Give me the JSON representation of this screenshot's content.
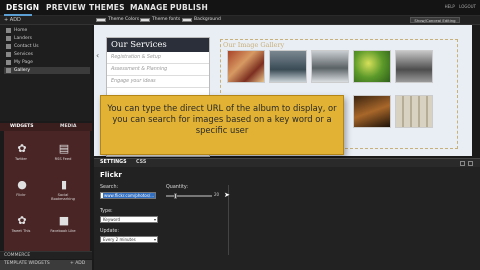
{
  "nav": {
    "tabs": [
      "DESIGN",
      "PREVIEW",
      "THEMES",
      "MANAGE",
      "PUBLISH"
    ],
    "right_links": [
      "HELP",
      "LOGOUT"
    ]
  },
  "toolbar": {
    "add_label": "+ ADD",
    "theme_colors": "Theme Colors",
    "theme_fonts": "Theme fonts",
    "background": "Background",
    "right_button": "Show/Conceal Editing"
  },
  "pages": {
    "items": [
      "Home",
      "Landers",
      "Contact Us",
      "Services",
      "My Page",
      "Gallery"
    ],
    "selected_index": 5
  },
  "widgets_panel": {
    "tabs": [
      "WIDGETS",
      "MEDIA"
    ],
    "items": [
      {
        "label": "Twitter",
        "icon": "twitter-icon"
      },
      {
        "label": "RSS Feed",
        "icon": "rss-icon"
      },
      {
        "label": "Flickr",
        "icon": "flickr-icon"
      },
      {
        "label": "Social Bookmarking",
        "icon": "bookmark-icon"
      },
      {
        "label": "Tweet This",
        "icon": "tweet-icon"
      },
      {
        "label": "Facebook Like",
        "icon": "facebook-icon"
      }
    ]
  },
  "left_footer": {
    "commerce": "COMMERCE",
    "template_widgets": "TEMPLATE WIDGETS",
    "add": "+ ADD"
  },
  "canvas": {
    "services": {
      "title": "Our Services",
      "items": [
        "Registration & Setup",
        "Assessment & Planning",
        "Engage your ideas"
      ]
    },
    "gallery": {
      "title": "Our Image Gallery"
    },
    "tooltip": "You can type the direct URL of the album to display, or you can search for images based on a key word or a specific user"
  },
  "settings": {
    "tabs": [
      "SETTINGS",
      "CSS"
    ],
    "title": "Flickr",
    "search_label": "Search:",
    "search_value": "www.flickr.com/photos/...",
    "quantity_label": "Quantity:",
    "quantity_value": "20",
    "type_label": "Type:",
    "type_value": "Keyword",
    "update_label": "Update:",
    "update_value": "Every 2 minutes"
  }
}
